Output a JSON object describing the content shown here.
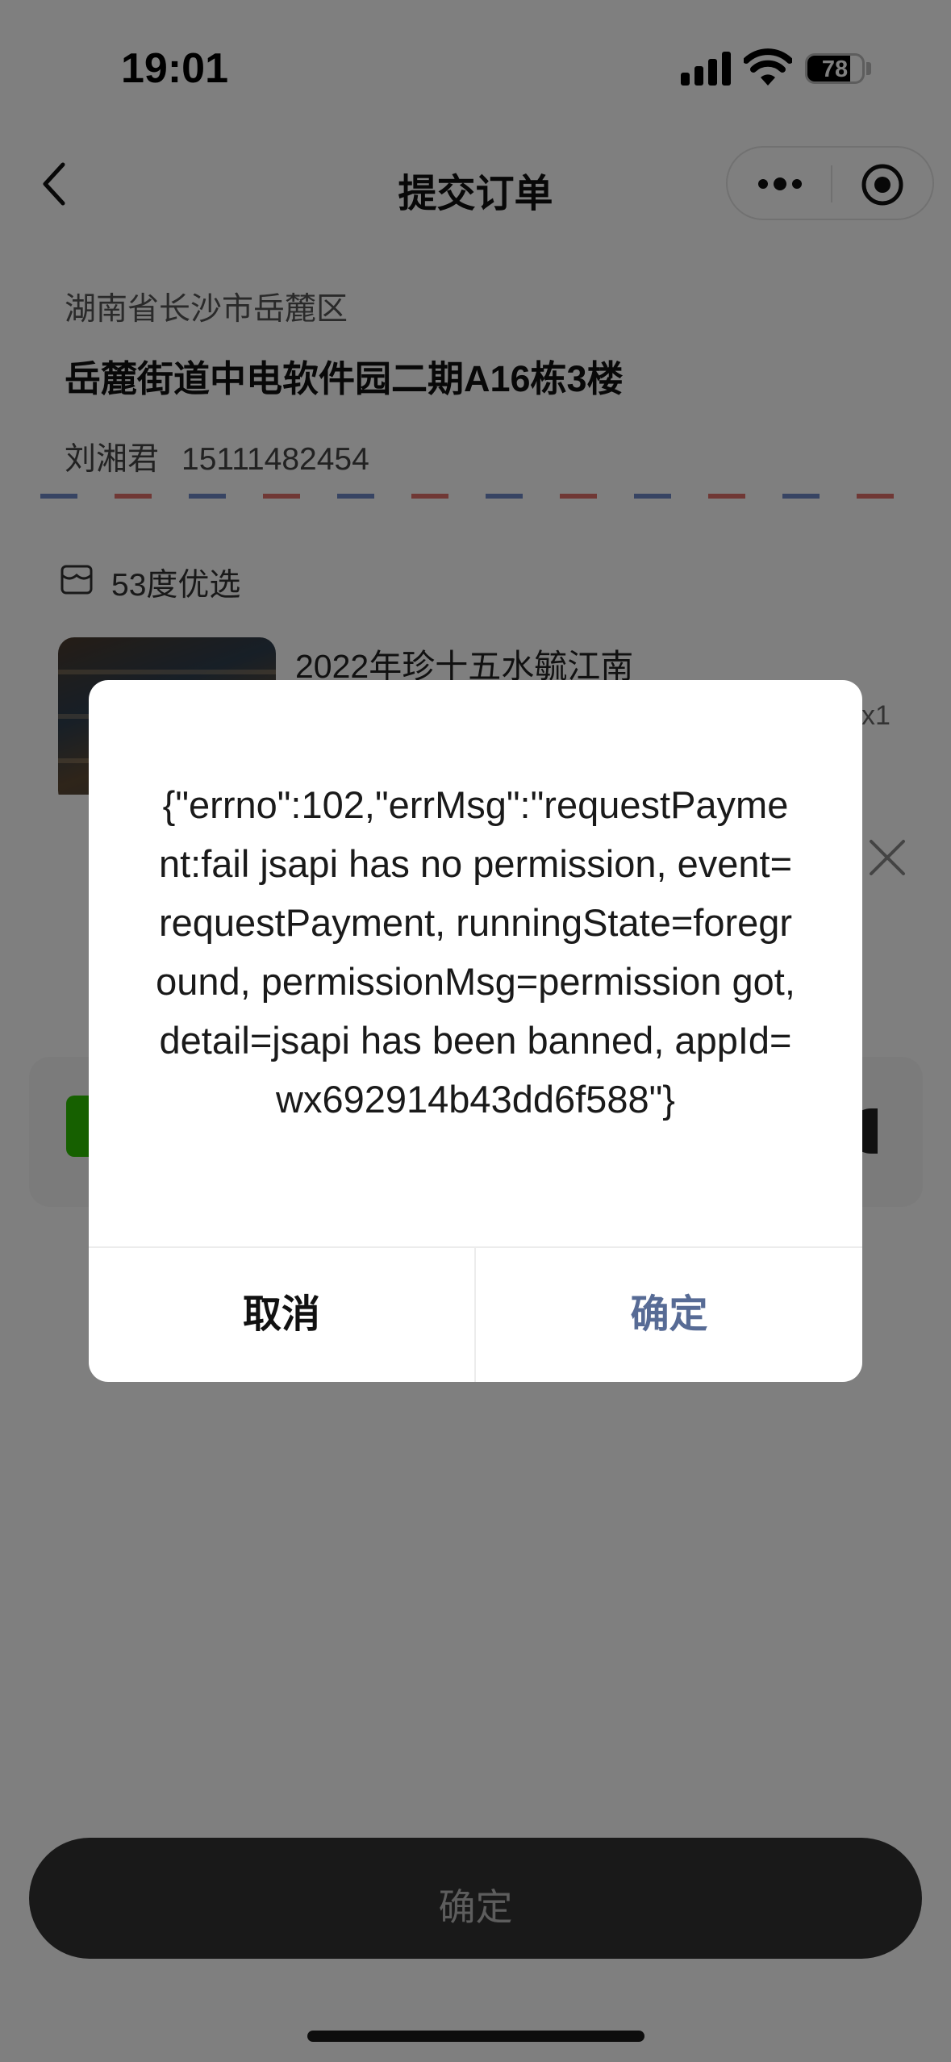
{
  "status_bar": {
    "time": "19:01",
    "battery_percent": "78"
  },
  "nav": {
    "title": "提交订单"
  },
  "address": {
    "region": "湖南省长沙市岳麓区",
    "detail": "岳麓街道中电软件园二期A16栋3楼",
    "name": "刘湘君",
    "phone": "15111482454"
  },
  "store": {
    "name": "53度优选"
  },
  "product": {
    "name": "2022年珍十五水毓江南",
    "quantity": "x1"
  },
  "sheet": {
    "confirm_label": "确定"
  },
  "dialog": {
    "message": "{\"errno\":102,\"errMsg\":\"requestPayment:fail jsapi has no permission, event=requestPayment, runningState=foreground, permissionMsg=permission got, detail=jsapi has been banned, appId=wx692914b43dd6f588\"}",
    "cancel_label": "取消",
    "ok_label": "确定",
    "ok_color": "#576b95"
  },
  "colors": {
    "pay_green": "#2dc100",
    "stripe_red": "#e0706a",
    "stripe_blue": "#6f89c7"
  }
}
